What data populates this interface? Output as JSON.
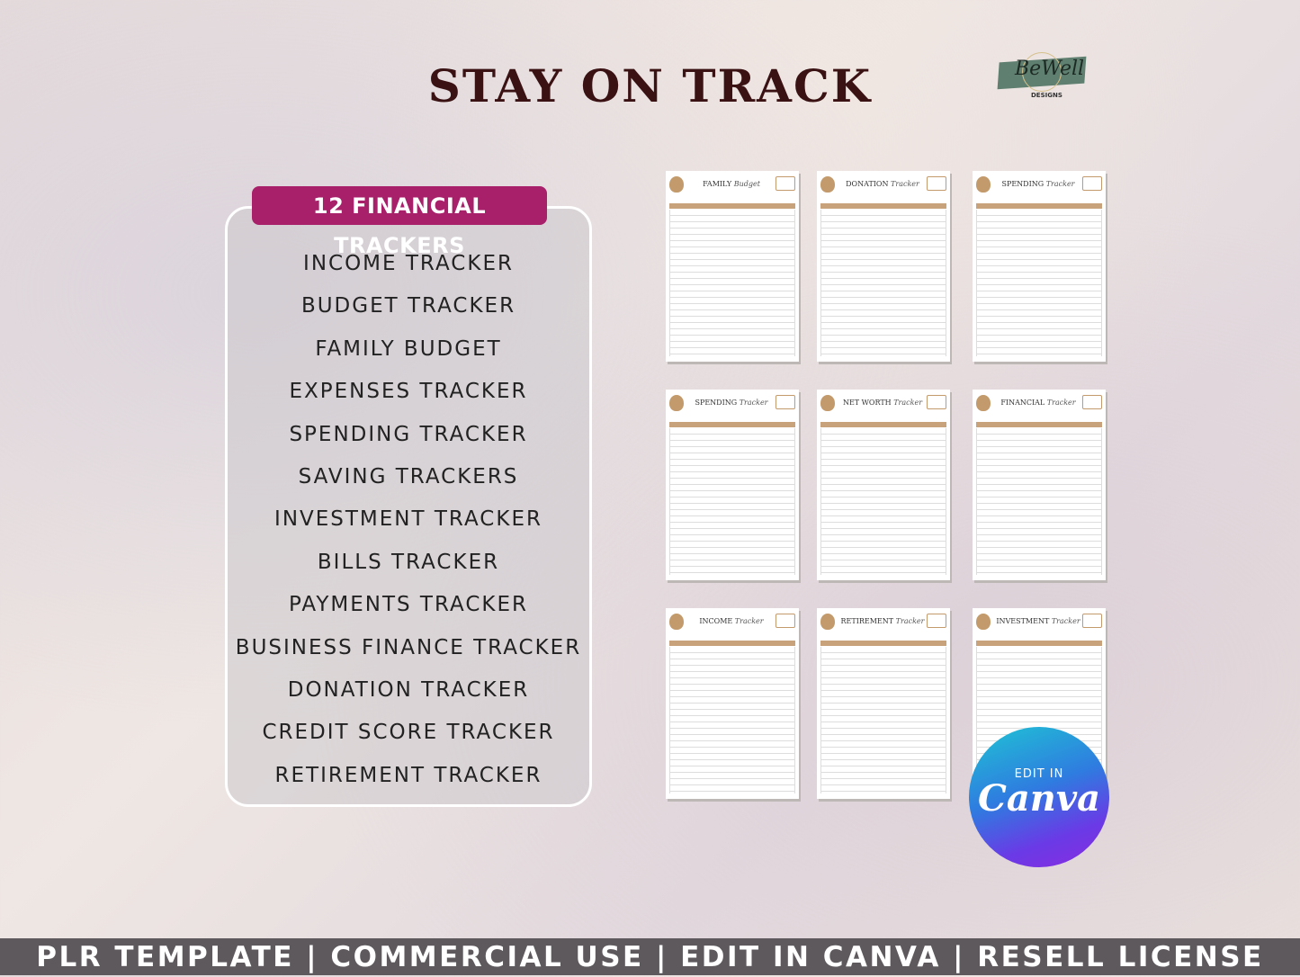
{
  "header": {
    "title": "STAY ON TRACK"
  },
  "logo": {
    "script": "BeWell",
    "sub": "DESIGNS",
    "color": "#5f7f70"
  },
  "badge": {
    "label": "12 FINANCIAL TRACKERS",
    "color": "#a8206a"
  },
  "trackers": [
    "INCOME TRACKER",
    "BUDGET TRACKER",
    "FAMILY BUDGET",
    "EXPENSES TRACKER",
    "SPENDING TRACKER",
    "SAVING TRACKERS",
    "INVESTMENT TRACKER",
    "BILLS TRACKER",
    "PAYMENTS TRACKER",
    "BUSINESS FINANCE TRACKER",
    "DONATION TRACKER",
    "CREDIT SCORE TRACKER",
    "RETIREMENT TRACKER"
  ],
  "previews": [
    {
      "name": "FAMILY",
      "script": "Budget"
    },
    {
      "name": "DONATION",
      "script": "Tracker"
    },
    {
      "name": "SPENDING",
      "script": "Tracker"
    },
    {
      "name": "SPENDING",
      "script": "Tracker"
    },
    {
      "name": "NET WORTH",
      "script": "Tracker"
    },
    {
      "name": "FINANCIAL",
      "script": "Tracker"
    },
    {
      "name": "INCOME",
      "script": "Tracker"
    },
    {
      "name": "RETIREMENT",
      "script": "Tracker"
    },
    {
      "name": "INVESTMENT",
      "script": "Tracker"
    }
  ],
  "canva": {
    "edit": "EDIT IN",
    "brand": "Canva"
  },
  "footer": {
    "text": "PLR TEMPLATE | COMMERCIAL USE | EDIT IN CANVA | RESELL LICENSE"
  },
  "accent": "#c8a27a"
}
